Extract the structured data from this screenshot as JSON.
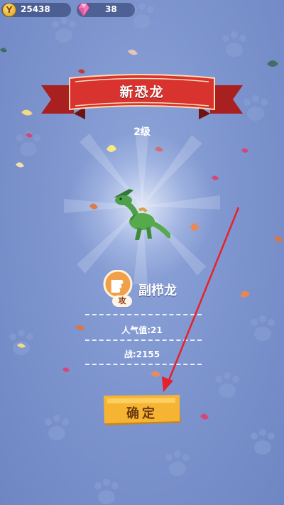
{
  "hud": {
    "coins": "25438",
    "gems": "38",
    "coin_icon_glyph": "Y"
  },
  "banner": {
    "title": "新恐龙"
  },
  "level": "2级",
  "dinosaur": {
    "name": "副栉龙",
    "attribute_tag": "攻",
    "popularity": "人气值:21",
    "power": "战:2155"
  },
  "confirm_button": {
    "label": "确定"
  },
  "colors": {
    "background": "#7e95cf",
    "banner_red": "#c9302c",
    "button_gold": "#f5b532",
    "arrow_red": "#e8202a"
  },
  "icons": [
    "coin-icon",
    "gem-icon",
    "paw-print-icon",
    "attack-fist-icon",
    "dinosaur-icon"
  ]
}
